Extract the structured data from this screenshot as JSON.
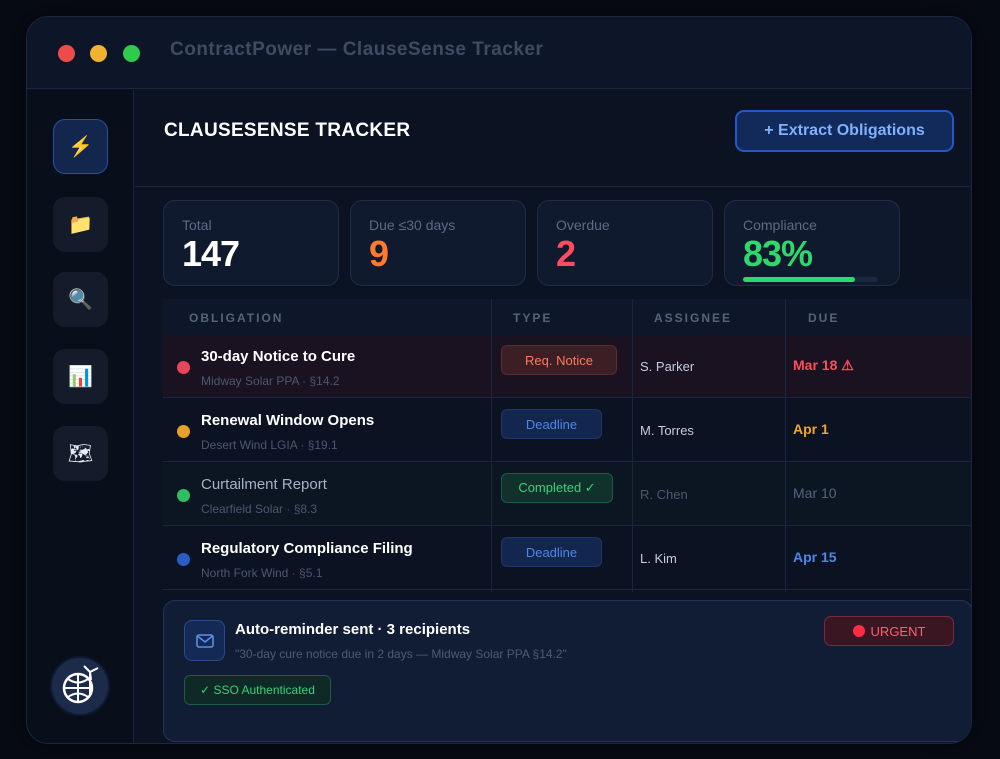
{
  "window": {
    "title": "ContractPower — ClauseSense Tracker"
  },
  "sidebar": {
    "items": [
      {
        "icon": "lightning-icon",
        "glyph": "⚡",
        "active": true
      },
      {
        "icon": "folder-icon",
        "glyph": "📁",
        "active": false
      },
      {
        "icon": "search-icon",
        "glyph": "🔍",
        "active": false
      },
      {
        "icon": "chart-icon",
        "glyph": "📊",
        "active": false
      },
      {
        "icon": "map-icon",
        "glyph": "🗺",
        "active": false
      }
    ],
    "avatar_icon": "globe-wind-turbine-icon"
  },
  "header": {
    "title": "CLAUSESENSE TRACKER",
    "action_label": "+ Extract Obligations"
  },
  "stats": [
    {
      "label": "Total",
      "value": "147",
      "color": "#ffffff"
    },
    {
      "label": "Due ≤30 days",
      "value": "9",
      "color": "#ff7a2f"
    },
    {
      "label": "Overdue",
      "value": "2",
      "color": "#ff4d5e"
    },
    {
      "label": "Compliance",
      "value": "83%",
      "color": "#2ed86a",
      "progress_percent": 83
    }
  ],
  "table": {
    "headers": [
      "OBLIGATION",
      "TYPE",
      "ASSIGNEE",
      "DUE"
    ],
    "rows": [
      {
        "title": "30-day Notice to Cure",
        "source": "Midway Solar PPA · §14.2",
        "type": "Req. Notice",
        "assignee": "S. Parker",
        "due": "Mar 18 ⚠",
        "dot_color": "#e8455a",
        "due_color": "#ff4d5e",
        "chip_bg": "#3c1f25",
        "chip_fg": "#ff7a5a",
        "chip_border": "#5a2b2f"
      },
      {
        "title": "Renewal Window Opens",
        "source": "Desert Wind LGIA · §19.1",
        "type": "Deadline",
        "assignee": "M. Torres",
        "due": "Apr 1",
        "dot_color": "#e7a02a",
        "due_color": "#f5a524",
        "chip_bg": "#13264d",
        "chip_fg": "#4f86ea",
        "chip_border": "#1c366a"
      },
      {
        "title": "Curtailment Report",
        "source": "Clearfield Solar · §8.3",
        "type": "Completed ✓",
        "assignee": "R. Chen",
        "due": "Mar 10",
        "dot_color": "#2fbf62",
        "due_color": "#56637d",
        "chip_bg": "#10322a",
        "chip_fg": "#3fd07f",
        "chip_border": "#1c5b42"
      },
      {
        "title": "Regulatory Compliance Filing",
        "source": "North Fork Wind · §5.1",
        "type": "Deadline",
        "assignee": "L. Kim",
        "due": "Apr 15",
        "dot_color": "#2a5cc6",
        "due_color": "#4f86ea",
        "chip_bg": "#13264d",
        "chip_fg": "#4f86ea",
        "chip_border": "#1c366a"
      }
    ]
  },
  "alert": {
    "icon": "mail-icon",
    "title": "Auto-reminder sent · 3 recipients",
    "quote": "\"30-day cure notice due in 2 days — Midway Solar PPA §14.2\"",
    "urgent_label": "URGENT",
    "sso_label": "✓ SSO Authenticated"
  }
}
